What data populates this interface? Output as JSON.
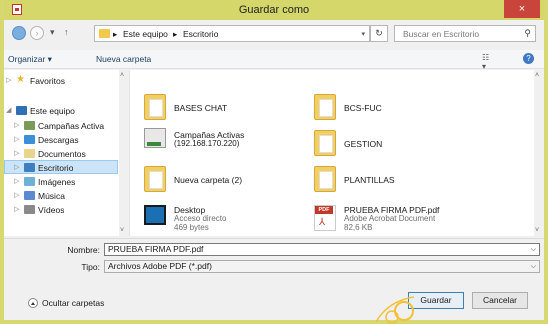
{
  "window": {
    "title": "Guardar como",
    "close": "×"
  },
  "address": {
    "crumbs": [
      "Este equipo",
      "Escritorio"
    ],
    "separator": "▸",
    "search_placeholder": "Buscar en Escritorio"
  },
  "toolbar": {
    "organize": "Organizar ▾",
    "new_folder": "Nueva carpeta"
  },
  "nav": {
    "items": [
      {
        "label": "Favoritos"
      },
      {
        "label": "Este equipo"
      },
      {
        "label": "Campañas Activa"
      },
      {
        "label": "Descargas"
      },
      {
        "label": "Documentos"
      },
      {
        "label": "Escritorio"
      },
      {
        "label": "Imágenes"
      },
      {
        "label": "Música"
      },
      {
        "label": "Vídeos"
      }
    ]
  },
  "files": [
    {
      "name": "BASES CHAT"
    },
    {
      "name": "BCS-FUC"
    },
    {
      "name": "Campañas Activas",
      "sub": "(192.168.170.220)"
    },
    {
      "name": "GESTION"
    },
    {
      "name": "Nueva carpeta (2)"
    },
    {
      "name": "PLANTILLAS"
    },
    {
      "name": "Desktop",
      "sub1": "Acceso directo",
      "sub2": "469 bytes"
    },
    {
      "name": "PRUEBA FIRMA PDF.pdf",
      "sub1": "Adobe Acrobat Document",
      "sub2": "82,6 KB"
    }
  ],
  "form": {
    "name_label": "Nombre:",
    "name_value": "PRUEBA FIRMA PDF.pdf",
    "type_label": "Tipo:",
    "type_value": "Archivos Adobe PDF (*.pdf)"
  },
  "footer": {
    "hide_folders": "Ocultar carpetas",
    "save": "Guardar",
    "cancel": "Cancelar"
  },
  "colors": {
    "titlebar": "#d6d76b",
    "close": "#c9443a",
    "selected": "#cce4f7",
    "background": "#3f7d2a"
  }
}
